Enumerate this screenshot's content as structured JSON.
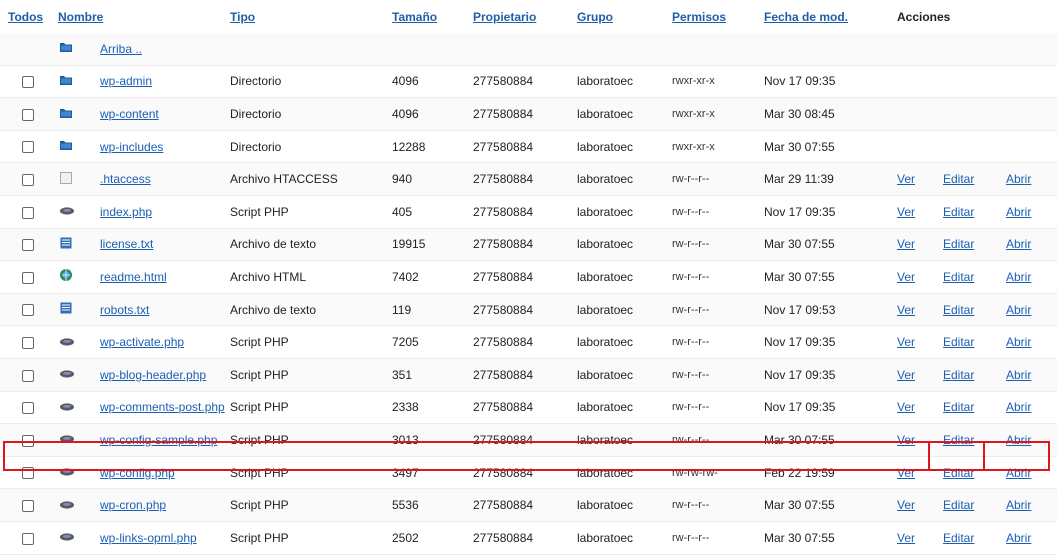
{
  "header": {
    "todos": "Todos",
    "nombre": "Nombre",
    "tipo": "Tipo",
    "tamano": "Tamaño",
    "propietario": "Propietario",
    "grupo": "Grupo",
    "permisos": "Permisos",
    "fecha": "Fecha de mod.",
    "acciones": "Acciones"
  },
  "up": {
    "label": "Arriba .."
  },
  "actions": {
    "ver": "Ver",
    "editar": "Editar",
    "abrir": "Abrir"
  },
  "rows": [
    {
      "name": "wp-admin",
      "type": "Directorio",
      "size": "4096",
      "owner": "277580884",
      "group": "laboratoec",
      "perms": "rwxr-xr-x",
      "date": "Nov 17 09:35",
      "icon": "folder-icon",
      "actions": false
    },
    {
      "name": "wp-content",
      "type": "Directorio",
      "size": "4096",
      "owner": "277580884",
      "group": "laboratoec",
      "perms": "rwxr-xr-x",
      "date": "Mar 30 08:45",
      "icon": "folder-icon",
      "actions": false
    },
    {
      "name": "wp-includes",
      "type": "Directorio",
      "size": "12288",
      "owner": "277580884",
      "group": "laboratoec",
      "perms": "rwxr-xr-x",
      "date": "Mar 30 07:55",
      "icon": "folder-icon",
      "actions": false
    },
    {
      "name": ".htaccess",
      "type": "Archivo HTACCESS",
      "size": "940",
      "owner": "277580884",
      "group": "laboratoec",
      "perms": "rw-r--r--",
      "date": "Mar 29 11:39",
      "icon": "blank-file-icon",
      "actions": true
    },
    {
      "name": "index.php",
      "type": "Script PHP",
      "size": "405",
      "owner": "277580884",
      "group": "laboratoec",
      "perms": "rw-r--r--",
      "date": "Nov 17 09:35",
      "icon": "php-file-icon",
      "actions": true
    },
    {
      "name": "license.txt",
      "type": "Archivo de texto",
      "size": "19915",
      "owner": "277580884",
      "group": "laboratoec",
      "perms": "rw-r--r--",
      "date": "Mar 30 07:55",
      "icon": "text-file-icon",
      "actions": true
    },
    {
      "name": "readme.html",
      "type": "Archivo HTML",
      "size": "7402",
      "owner": "277580884",
      "group": "laboratoec",
      "perms": "rw-r--r--",
      "date": "Mar 30 07:55",
      "icon": "html-file-icon",
      "actions": true
    },
    {
      "name": "robots.txt",
      "type": "Archivo de texto",
      "size": "119",
      "owner": "277580884",
      "group": "laboratoec",
      "perms": "rw-r--r--",
      "date": "Nov 17 09:53",
      "icon": "text-file-icon",
      "actions": true
    },
    {
      "name": "wp-activate.php",
      "type": "Script PHP",
      "size": "7205",
      "owner": "277580884",
      "group": "laboratoec",
      "perms": "rw-r--r--",
      "date": "Nov 17 09:35",
      "icon": "php-file-icon",
      "actions": true
    },
    {
      "name": "wp-blog-header.php",
      "type": "Script PHP",
      "size": "351",
      "owner": "277580884",
      "group": "laboratoec",
      "perms": "rw-r--r--",
      "date": "Nov 17 09:35",
      "icon": "php-file-icon",
      "actions": true
    },
    {
      "name": "wp-comments-post.php",
      "type": "Script PHP",
      "size": "2338",
      "owner": "277580884",
      "group": "laboratoec",
      "perms": "rw-r--r--",
      "date": "Nov 17 09:35",
      "icon": "php-file-icon",
      "actions": true
    },
    {
      "name": "wp-config-sample.php",
      "type": "Script PHP",
      "size": "3013",
      "owner": "277580884",
      "group": "laboratoec",
      "perms": "rw-r--r--",
      "date": "Mar 30 07:55",
      "icon": "php-file-icon",
      "actions": true
    },
    {
      "name": "wp-config.php",
      "type": "Script PHP",
      "size": "3497",
      "owner": "277580884",
      "group": "laboratoec",
      "perms": "rw-rw-rw-",
      "date": "Feb 22 19:59",
      "icon": "php-file-icon",
      "actions": true
    },
    {
      "name": "wp-cron.php",
      "type": "Script PHP",
      "size": "5536",
      "owner": "277580884",
      "group": "laboratoec",
      "perms": "rw-r--r--",
      "date": "Mar 30 07:55",
      "icon": "php-file-icon",
      "actions": true
    },
    {
      "name": "wp-links-opml.php",
      "type": "Script PHP",
      "size": "2502",
      "owner": "277580884",
      "group": "laboratoec",
      "perms": "rw-r--r--",
      "date": "Mar 30 07:55",
      "icon": "php-file-icon",
      "actions": true
    }
  ]
}
